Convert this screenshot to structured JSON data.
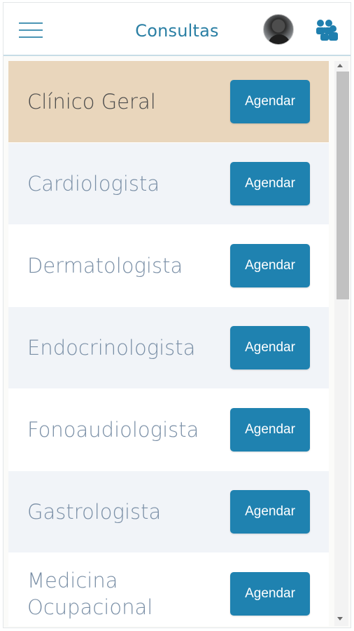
{
  "header": {
    "title": "Consultas"
  },
  "icons": {
    "menu": "menu-icon",
    "avatar": "avatar",
    "group": "users-group-icon"
  },
  "colors": {
    "accent": "#1f82b0",
    "title": "#2a7fa4",
    "active_row": "#e9d6bc",
    "row_bg": "#f1f4f8"
  },
  "specialties": [
    {
      "name": "Clínico Geral",
      "button": "Agendar",
      "selected": true
    },
    {
      "name": "Cardiologista",
      "button": "Agendar"
    },
    {
      "name": "Dermatologista",
      "button": "Agendar"
    },
    {
      "name": "Endocrinologista",
      "button": "Agendar"
    },
    {
      "name": "Fonoaudiologista",
      "button": "Agendar"
    },
    {
      "name": "Gastrologista",
      "button": "Agendar"
    },
    {
      "name": "Medicina Ocupacional",
      "button": "Agendar"
    }
  ]
}
